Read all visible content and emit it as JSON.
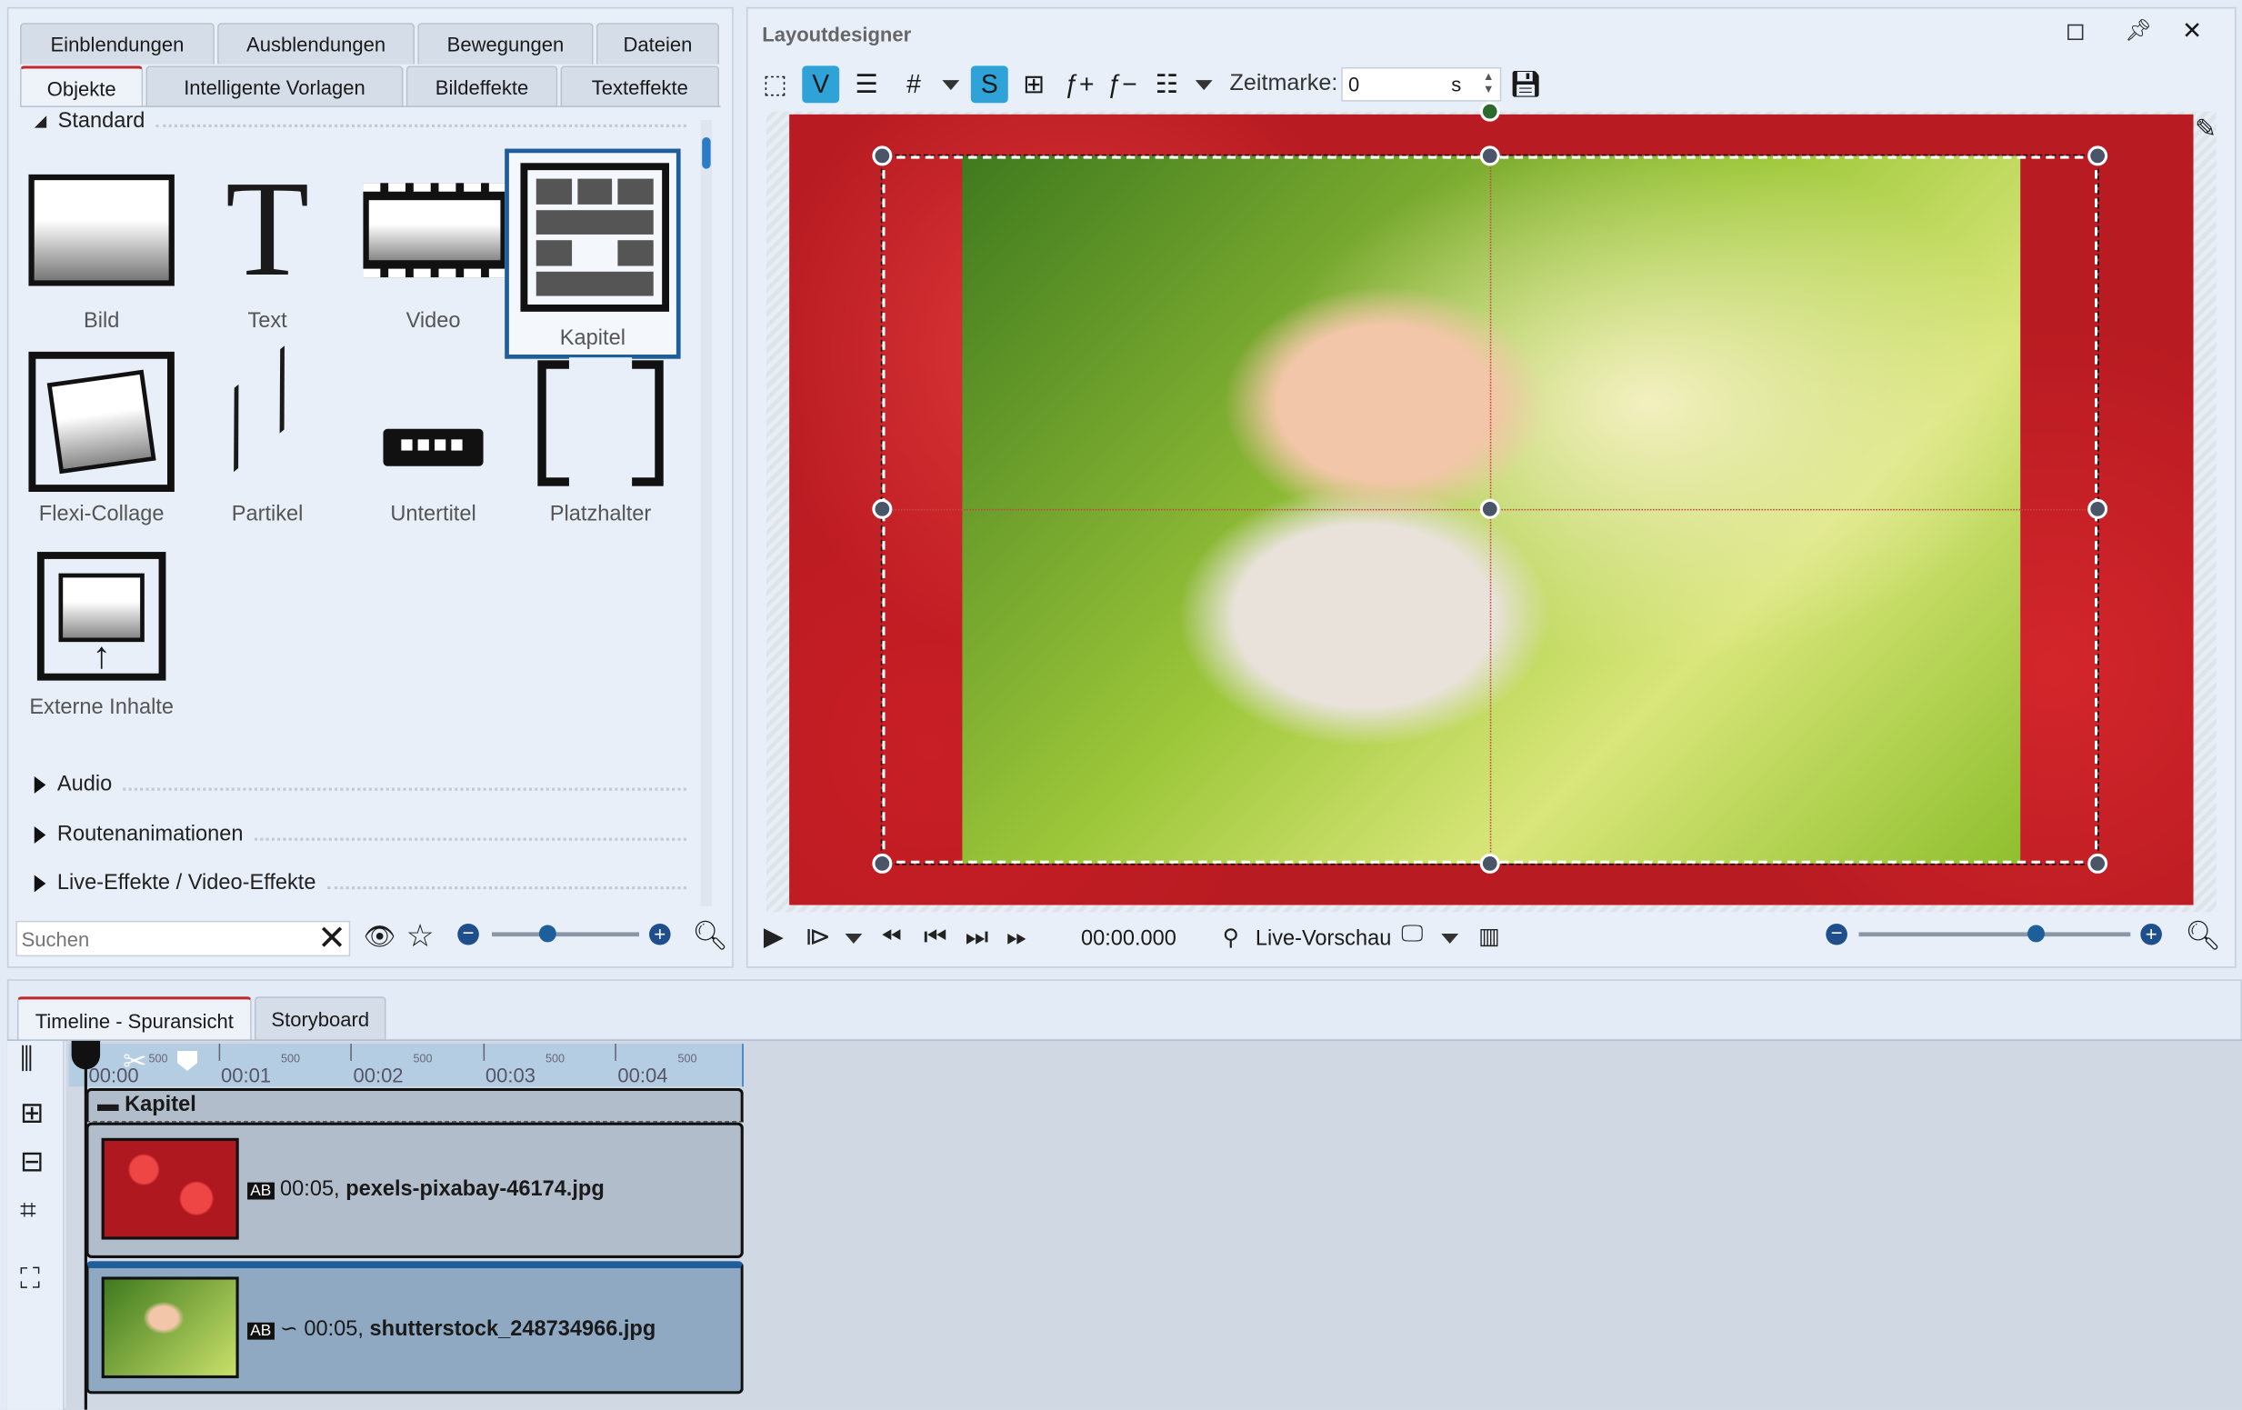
{
  "left_panel": {
    "tabs_row1": [
      "Einblendungen",
      "Ausblendungen",
      "Bewegungen",
      "Dateien"
    ],
    "tabs_row2": [
      "Objekte",
      "Intelligente Vorlagen",
      "Bildeffekte",
      "Texteffekte"
    ],
    "active_tab": "Objekte",
    "section_standard": "Standard",
    "items": [
      "Bild",
      "Text",
      "Video",
      "Kapitel",
      "Flexi-Collage",
      "Partikel",
      "Untertitel",
      "Platzhalter",
      "Externe Inhalte"
    ],
    "selected_item": "Kapitel",
    "sections": [
      "Audio",
      "Routenanimationen",
      "Live-Effekte / Video-Effekte"
    ],
    "search_placeholder": "Suchen"
  },
  "layout_designer": {
    "title": "Layoutdesigner",
    "zeitmarke_label": "Zeitmarke:",
    "zeitmarke_value": "0",
    "zeitmarke_unit": "s",
    "time": "00:00.000",
    "live_preview": "Live-Vorschau",
    "accent": "#2fa3d8"
  },
  "bottom": {
    "tabs": [
      "Timeline - Spuransicht",
      "Storyboard"
    ],
    "ruler": [
      "00:00",
      "00:01",
      "00:02",
      "00:03",
      "00:04"
    ],
    "ruler_minor": "500",
    "chapter": "Kapitel",
    "tracks": [
      {
        "duration": "00:05,",
        "file": "pexels-pixabay-46174.jpg"
      },
      {
        "duration": "00:05,",
        "file": "shutterstock_248734966.jpg"
      }
    ]
  }
}
